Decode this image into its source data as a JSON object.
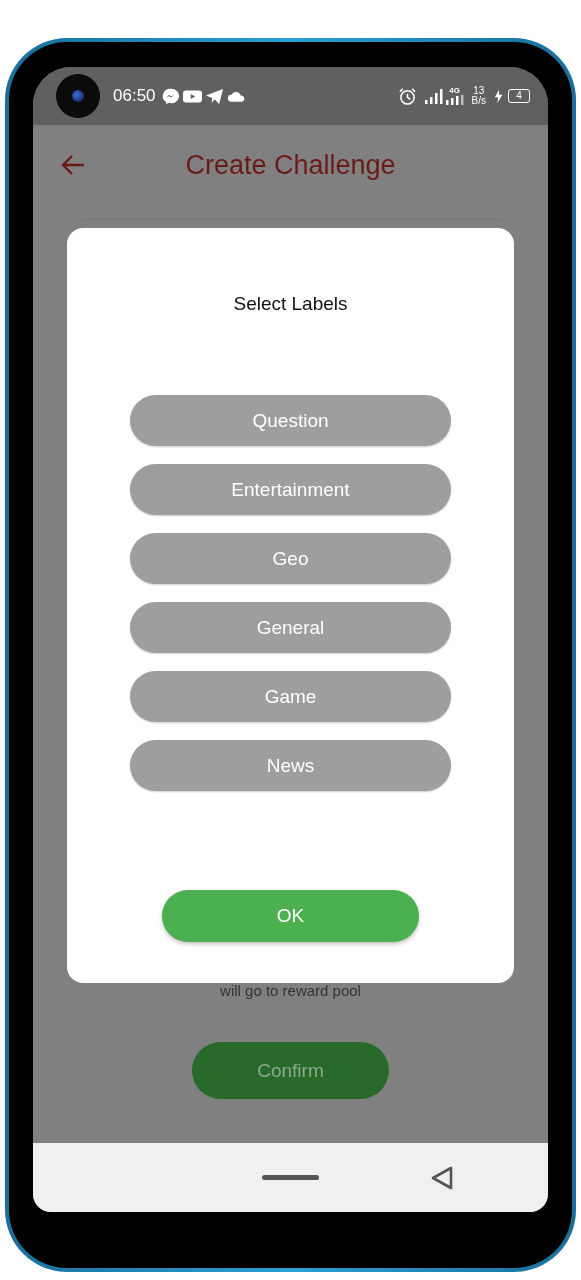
{
  "status_bar": {
    "time": "06:50",
    "network_type": "4G",
    "speed_value": "13",
    "speed_unit": "B/s",
    "battery": "4"
  },
  "header": {
    "title": "Create Challenge"
  },
  "background": {
    "note": "will go to reward pool",
    "confirm_button": "Confirm"
  },
  "dialog": {
    "title": "Select Labels",
    "labels": [
      {
        "label": "Question",
        "selected": false
      },
      {
        "label": "Entertainment",
        "selected": false
      },
      {
        "label": "Geo",
        "selected": false
      },
      {
        "label": "General",
        "selected": false
      },
      {
        "label": "Game",
        "selected": false
      },
      {
        "label": "News",
        "selected": false
      }
    ],
    "ok_button": "OK"
  }
}
